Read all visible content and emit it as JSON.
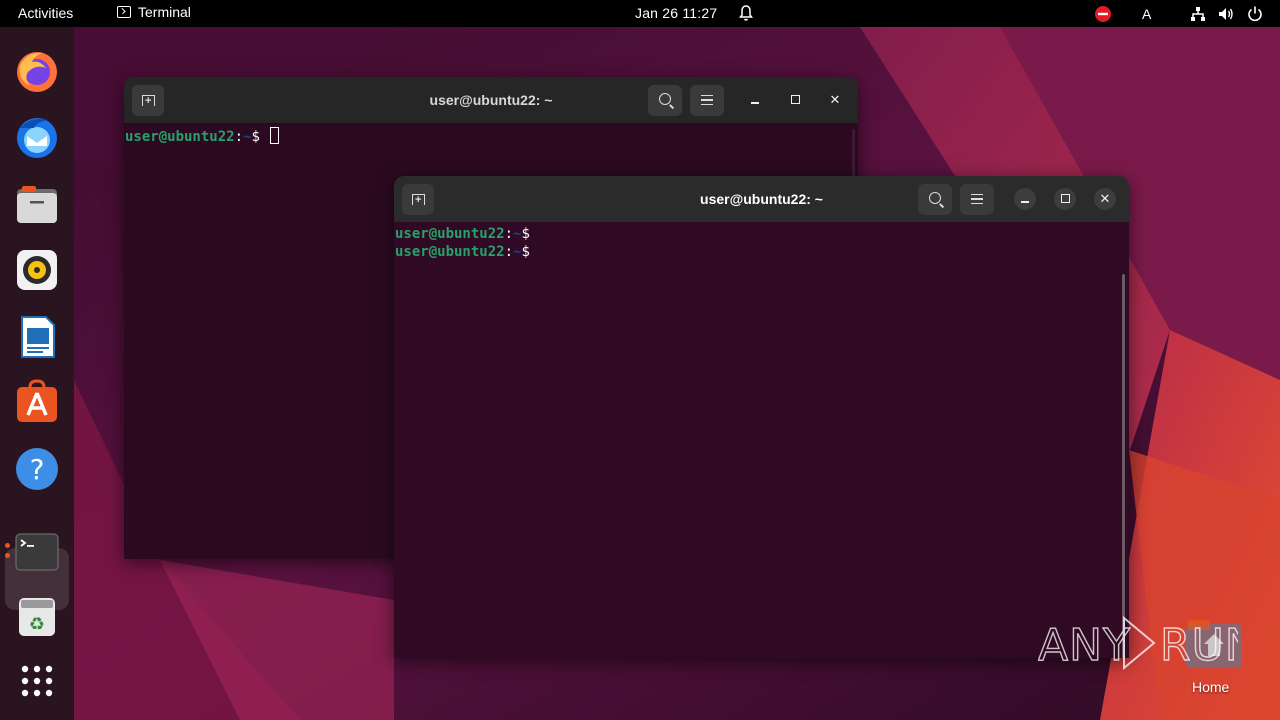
{
  "topbar": {
    "activities": "Activities",
    "app_name": "Terminal",
    "clock": "Jan 26  11:27",
    "keyboard_layout": "A"
  },
  "dock": {
    "items": [
      {
        "name": "Firefox",
        "icon": "firefox-icon"
      },
      {
        "name": "Thunderbird",
        "icon": "thunderbird-icon"
      },
      {
        "name": "Files",
        "icon": "files-icon"
      },
      {
        "name": "Rhythmbox",
        "icon": "rhythmbox-icon"
      },
      {
        "name": "LibreOffice Writer",
        "icon": "writer-icon"
      },
      {
        "name": "Ubuntu Software",
        "icon": "software-icon"
      },
      {
        "name": "Help",
        "icon": "help-icon"
      },
      {
        "name": "Terminal",
        "icon": "terminal-icon",
        "running": true
      },
      {
        "name": "Trash",
        "icon": "trash-icon"
      },
      {
        "name": "Show Applications",
        "icon": "app-grid-icon"
      }
    ]
  },
  "windows": {
    "back": {
      "title": "user@ubuntu22: ~",
      "lines": [
        {
          "user": "user@ubuntu22",
          "sep": ":",
          "path": "~",
          "dollar": "$ "
        }
      ]
    },
    "front": {
      "title": "user@ubuntu22: ~",
      "lines": [
        {
          "user": "user@ubuntu22",
          "sep": ":",
          "path": "~",
          "dollar": "$"
        },
        {
          "user": "user@ubuntu22",
          "sep": ":",
          "path": "~",
          "dollar": "$"
        }
      ]
    }
  },
  "desktop": {
    "home_label": "Home",
    "watermark": "ANY RUN"
  },
  "colors": {
    "terminal_bg": "#300a24",
    "prompt_user": "#26a269",
    "prompt_path": "#12488b",
    "accent": "#e95420"
  }
}
